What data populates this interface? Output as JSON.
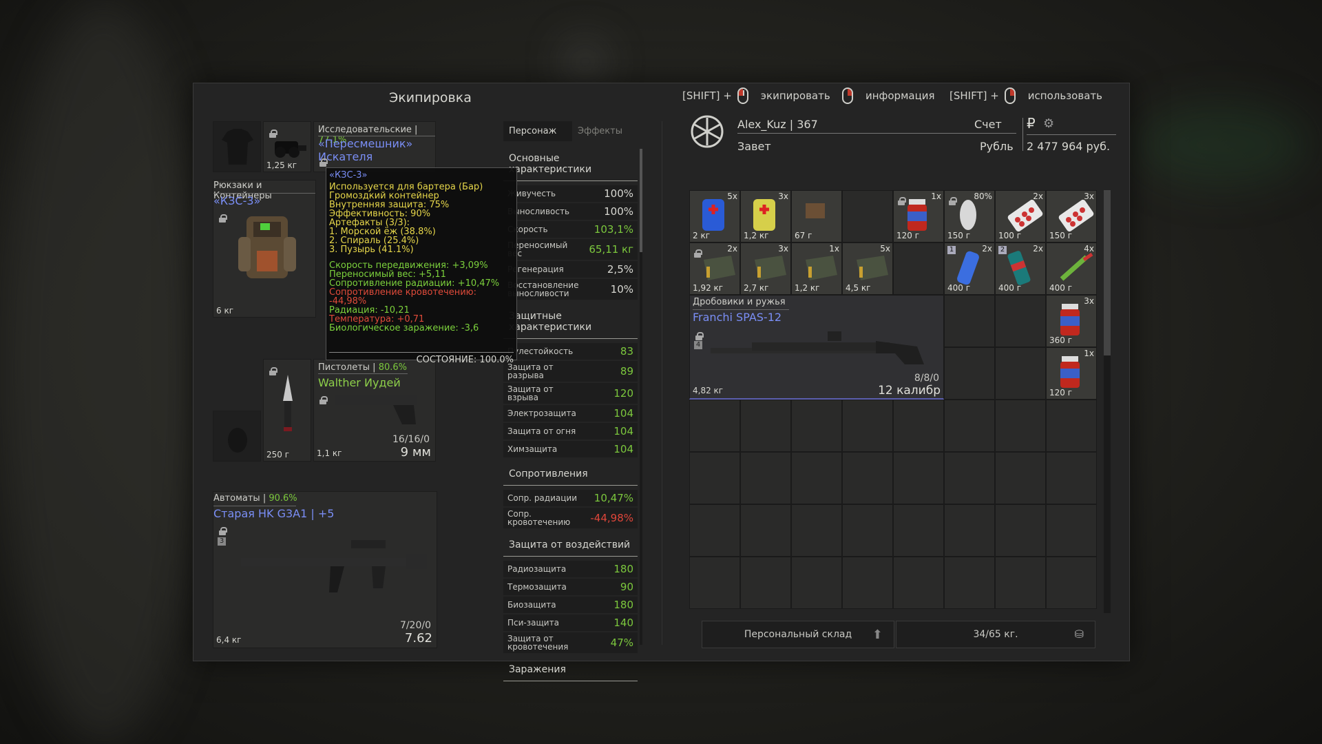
{
  "inventory": {
    "title": "Экипировка",
    "hints": [
      {
        "prefix": "[SHIFT] +",
        "label": "экипировать"
      },
      {
        "prefix": "",
        "label": "информация"
      },
      {
        "prefix": "[SHIFT] +",
        "label": "использовать"
      }
    ]
  },
  "equipment": {
    "top_slot_weight": "1,25 кг",
    "detector": {
      "category": "Исследовательские",
      "pct": "77.1%",
      "name": "«Пересмешник» Искателя"
    },
    "backpack": {
      "category": "Рюкзаки и Контейнеры",
      "name": "«КЗС-3»",
      "weight": "6 кг"
    },
    "knife": {
      "weight": "250 г"
    },
    "pistol": {
      "category": "Пистолеты",
      "pct": "80.6%",
      "name": "Walther Иудей",
      "ammo": "16/16/0",
      "caliber": "9 мм",
      "weight": "1,1 кг"
    },
    "rifle": {
      "category": "Автоматы",
      "pct": "90.6%",
      "name": "Старая HK G3A1",
      "upgrade": "| +5",
      "ammo": "7/20/0",
      "caliber": "7.62",
      "weight": "6,4 кг",
      "badge": "3"
    }
  },
  "tooltip": {
    "title": "«КЗС-3»",
    "lines_yellow": [
      "Используется для бартера (Бар)",
      "Громоздкий контейнер",
      "Внутренняя защита: 75%",
      "Эффективность: 90%",
      "Артефакты (3/3):",
      "1. Морской ёж (38.8%)",
      "2. Спираль (25.4%)",
      "3. Пузырь (41.1%)"
    ],
    "effects": [
      {
        "text": "Скорость передвижения: +3,09%",
        "tone": "g"
      },
      {
        "text": "Переносимый вес: +5,11",
        "tone": "g"
      },
      {
        "text": "Сопротивление радиации: +10,47%",
        "tone": "g"
      },
      {
        "text": "Сопротивление кровотечению: -44,98%",
        "tone": "r"
      },
      {
        "text": "Радиация: -10,21",
        "tone": "g"
      },
      {
        "text": "Температура: +0,71",
        "tone": "r"
      },
      {
        "text": "Биологическое заражение: -3,6",
        "tone": "g"
      }
    ],
    "condition": "СОСТОЯНИЕ: 100.0%"
  },
  "stats": {
    "tabs": [
      "Персонаж",
      "Эффекты"
    ],
    "sections": [
      {
        "title": "Основные характеристики",
        "rows": [
          {
            "label": "Живучесть",
            "value": "100%",
            "tone": ""
          },
          {
            "label": "Выносливость",
            "value": "100%",
            "tone": ""
          },
          {
            "label": "Скорость",
            "value": "103,1%",
            "tone": "g"
          },
          {
            "label": "Переносимый вес",
            "value": "65,11 кг",
            "tone": "g"
          },
          {
            "label": "Регенерация",
            "value": "2,5%",
            "tone": ""
          },
          {
            "label": "Восстановление выносливости",
            "value": "10%",
            "tone": ""
          }
        ]
      },
      {
        "title": "Защитные характеристики",
        "rows": [
          {
            "label": "Пулестойкость",
            "value": "83",
            "tone": "g"
          },
          {
            "label": "Защита от разрыва",
            "value": "89",
            "tone": "g"
          },
          {
            "label": "Защита от взрыва",
            "value": "120",
            "tone": "g"
          },
          {
            "label": "Электрозащита",
            "value": "104",
            "tone": "g"
          },
          {
            "label": "Защита от огня",
            "value": "104",
            "tone": "g"
          },
          {
            "label": "Химзащита",
            "value": "104",
            "tone": "g"
          }
        ]
      },
      {
        "title": "Сопротивления",
        "rows": [
          {
            "label": "Сопр. радиации",
            "value": "10,47%",
            "tone": "g"
          },
          {
            "label": "Сопр. кровотечению",
            "value": "-44,98%",
            "tone": "r"
          }
        ]
      },
      {
        "title": "Защита от воздействий",
        "rows": [
          {
            "label": "Радиозащита",
            "value": "180",
            "tone": "g"
          },
          {
            "label": "Термозащита",
            "value": "90",
            "tone": "g"
          },
          {
            "label": "Биозащита",
            "value": "180",
            "tone": "g"
          },
          {
            "label": "Пси-защита",
            "value": "140",
            "tone": "g"
          },
          {
            "label": "Защита от кровотечения",
            "value": "47%",
            "tone": "g"
          }
        ]
      },
      {
        "title": "Заражения",
        "rows": []
      }
    ]
  },
  "player": {
    "name": "Alex_Kuz | 367",
    "faction": "Завет",
    "account_label": "Счет",
    "currency_label": "Рубль",
    "balance": "2 477 964 руб.",
    "currency_symbol": "₽"
  },
  "items": [
    {
      "count": "5x",
      "weight": "2 кг",
      "kind": "medkit-blue"
    },
    {
      "count": "3x",
      "weight": "1,2 кг",
      "kind": "medkit-yellow"
    },
    {
      "count": "",
      "weight": "67 г",
      "kind": "box"
    },
    {
      "count": "",
      "weight": "",
      "kind": "empty"
    },
    {
      "count": "1x",
      "weight": "120 г",
      "kind": "jar",
      "lock": true
    },
    {
      "count": "80%",
      "weight": "150 г",
      "kind": "bandage",
      "lock": true
    },
    {
      "count": "2x",
      "weight": "100 г",
      "kind": "pills"
    },
    {
      "count": "3x",
      "weight": "150 г",
      "kind": "pills"
    },
    {
      "count": "2x",
      "weight": "1,92 кг",
      "kind": "ammo-box",
      "lock": true
    },
    {
      "count": "3x",
      "weight": "2,7 кг",
      "kind": "ammo-box"
    },
    {
      "count": "1x",
      "weight": "1,2 кг",
      "kind": "ammo-box"
    },
    {
      "count": "5x",
      "weight": "4,5 кг",
      "kind": "ammo-box"
    },
    {
      "count": "",
      "weight": "",
      "kind": "empty"
    },
    {
      "count": "2x",
      "weight": "400 г",
      "kind": "grenade-blue",
      "badge": "1"
    },
    {
      "count": "2x",
      "weight": "400 г",
      "kind": "grenade-stripe",
      "badge": "2"
    },
    {
      "count": "4x",
      "weight": "400 г",
      "kind": "injector"
    }
  ],
  "shotgun": {
    "category": "Дробовики и ружья",
    "name": "Franchi SPAS-12",
    "ammo": "8/8/0",
    "caliber": "12 калибр",
    "weight": "4,82 кг",
    "badge": "4"
  },
  "side_jars": [
    {
      "count": "3x",
      "weight": "360 г"
    },
    {
      "count": "1x",
      "weight": "120 г"
    }
  ],
  "footer": {
    "stash_label": "Персональный склад",
    "weight_label": "34/65 кг."
  }
}
